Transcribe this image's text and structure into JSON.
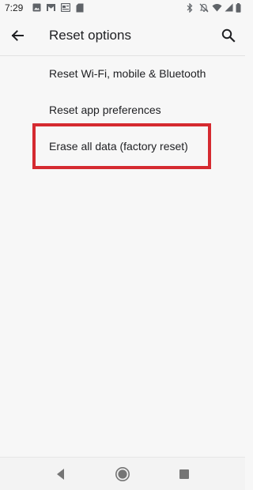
{
  "status_bar": {
    "time": "7:29",
    "left_icons": [
      "photo-icon",
      "gmail-icon",
      "news-icon",
      "storage-icon"
    ],
    "right_icons": [
      "bluetooth-icon",
      "mute-icon",
      "wifi-icon",
      "signal-icon",
      "battery-icon"
    ]
  },
  "app_bar": {
    "title": "Reset options",
    "back_icon": "arrow-back-icon",
    "search_icon": "search-icon"
  },
  "options": [
    {
      "label": "Reset Wi-Fi, mobile & Bluetooth"
    },
    {
      "label": "Reset app preferences"
    },
    {
      "label": "Erase all data (factory reset)",
      "highlighted": true
    }
  ],
  "highlight_color": "#d52a30",
  "nav_bar": {
    "icons": [
      "nav-back-icon",
      "nav-home-icon",
      "nav-recents-icon"
    ]
  }
}
